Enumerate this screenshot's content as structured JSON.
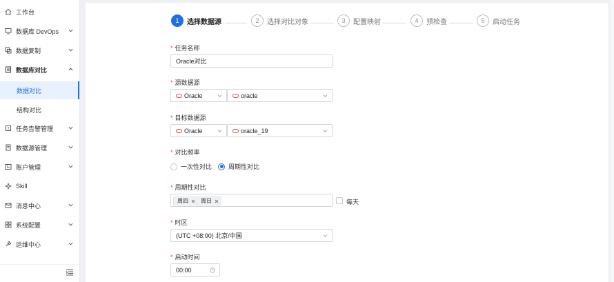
{
  "sidebar": {
    "items": [
      {
        "label": "工作台",
        "icon": "home-icon"
      },
      {
        "label": "数据库 DevOps",
        "icon": "devops-icon"
      },
      {
        "label": "数据复制",
        "icon": "copy-icon"
      },
      {
        "label": "数据库对比",
        "icon": "compare-icon"
      },
      {
        "label": "数据对比"
      },
      {
        "label": "结构对比"
      },
      {
        "label": "任务告警管理",
        "icon": "alarm-icon"
      },
      {
        "label": "数据源管理",
        "icon": "datasource-icon"
      },
      {
        "label": "账户管理",
        "icon": "account-icon"
      },
      {
        "label": "Skill",
        "icon": "skill-icon"
      },
      {
        "label": "消息中心",
        "icon": "mail-icon"
      },
      {
        "label": "系统配置",
        "icon": "grid-icon"
      },
      {
        "label": "运维中心",
        "icon": "wrench-icon"
      }
    ]
  },
  "steps": [
    {
      "num": "1",
      "label": "选择数据源"
    },
    {
      "num": "2",
      "label": "选择对比对象"
    },
    {
      "num": "3",
      "label": "配置映射"
    },
    {
      "num": "4",
      "label": "预检查"
    },
    {
      "num": "5",
      "label": "启动任务"
    }
  ],
  "form": {
    "required_mark": "*",
    "task_name": {
      "label": "任务名称",
      "value": "Oracle对比"
    },
    "source": {
      "label": "源数据源",
      "type": "Oracle",
      "instance": "oracle"
    },
    "target": {
      "label": "目标数据源",
      "type": "Oracle",
      "instance": "oracle_19"
    },
    "frequency": {
      "label": "对比频率",
      "options": [
        "一次性对比",
        "周期性对比"
      ],
      "selected": "周期性对比"
    },
    "periodic": {
      "label": "周期性对比",
      "tags": [
        "周四",
        "周日"
      ],
      "daily_label": "每天",
      "daily_checked": false
    },
    "timezone": {
      "label": "时区",
      "value": "(UTC +08:00) 北京/中国"
    },
    "start_time": {
      "label": "启动时间",
      "value": "00:00"
    }
  },
  "colors": {
    "accent": "#1f6fe5",
    "required": "#e5484d",
    "oracle": "#e5484d"
  }
}
